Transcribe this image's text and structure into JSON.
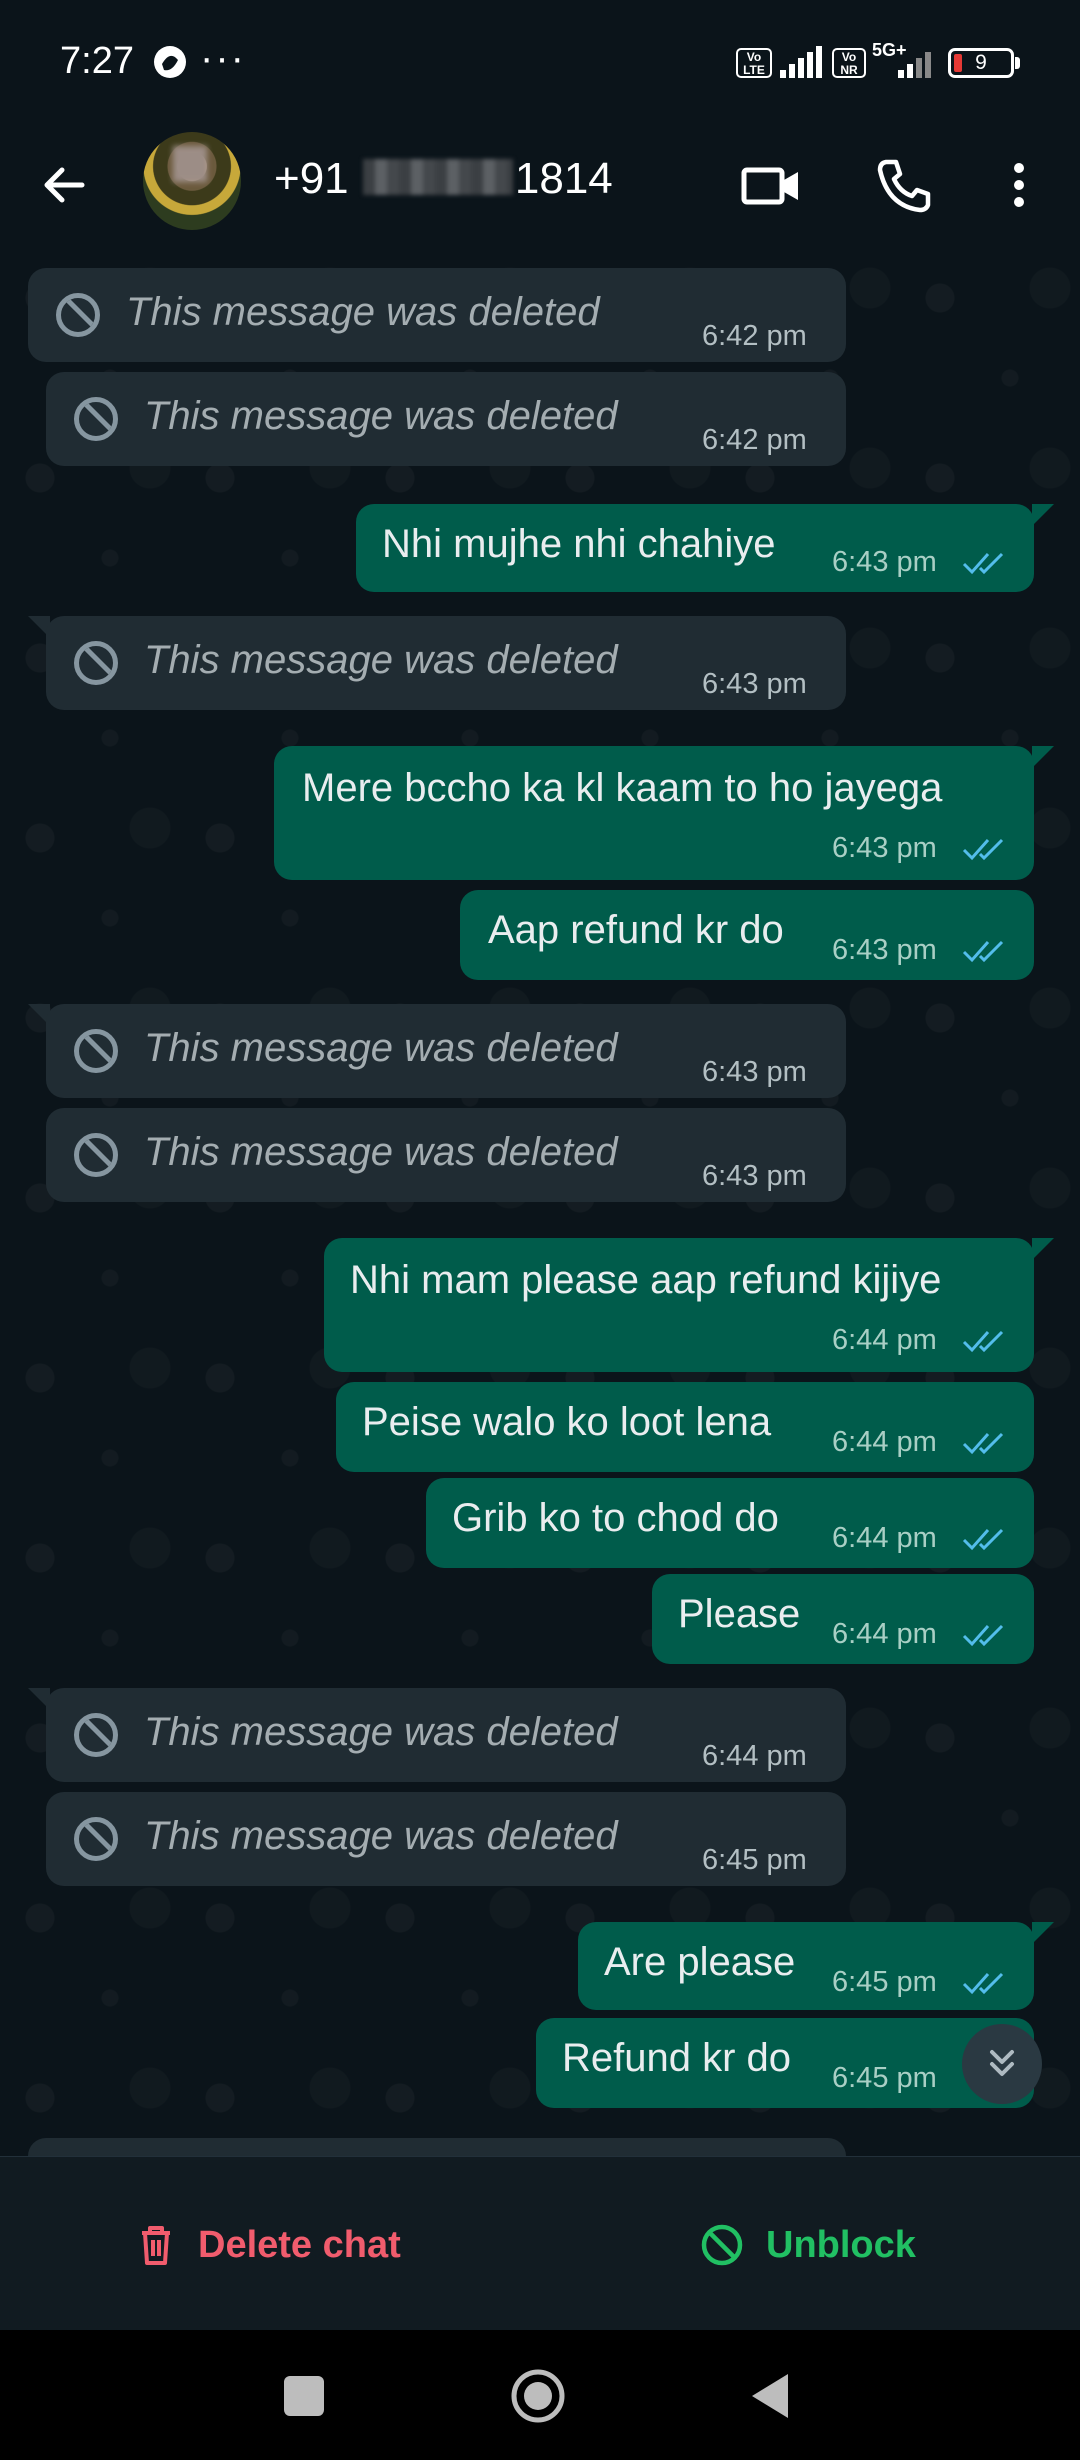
{
  "status_bar": {
    "time": "7:27",
    "dots": "···",
    "vo_lte_1": "Vo LTE",
    "vo_lte_2": "Vo NR",
    "network": "5G+",
    "battery": "9"
  },
  "header": {
    "contact_prefix": "+91",
    "contact_suffix": "1814",
    "icons": [
      "back-arrow-icon",
      "video-call-icon",
      "voice-call-icon",
      "more-vert-icon"
    ]
  },
  "messages": [
    {
      "dir": "in",
      "deleted": true,
      "text": "This message was deleted",
      "time": "6:42 pm"
    },
    {
      "dir": "in",
      "deleted": true,
      "text": "This message was deleted",
      "time": "6:42 pm"
    },
    {
      "dir": "out",
      "text": "Nhi mujhe nhi chahiye",
      "time": "6:43 pm"
    },
    {
      "dir": "in",
      "deleted": true,
      "text": "This message was deleted",
      "time": "6:43 pm"
    },
    {
      "dir": "out",
      "text": "Mere bccho ka kl kaam to ho jayega",
      "time": "6:43 pm"
    },
    {
      "dir": "out",
      "text": "Aap refund kr do",
      "time": "6:43 pm"
    },
    {
      "dir": "in",
      "deleted": true,
      "text": "This message was deleted",
      "time": "6:43 pm"
    },
    {
      "dir": "in",
      "deleted": true,
      "text": "This message was deleted",
      "time": "6:43 pm"
    },
    {
      "dir": "out",
      "text": "Nhi mam please aap refund kijiye",
      "time": "6:44 pm"
    },
    {
      "dir": "out",
      "text": "Peise walo ko loot lena",
      "time": "6:44 pm"
    },
    {
      "dir": "out",
      "text": "Grib ko to chod do",
      "time": "6:44 pm"
    },
    {
      "dir": "out",
      "text": "Please",
      "time": "6:44 pm"
    },
    {
      "dir": "in",
      "deleted": true,
      "text": "This message was deleted",
      "time": "6:44 pm"
    },
    {
      "dir": "in",
      "deleted": true,
      "text": "This message was deleted",
      "time": "6:45 pm"
    },
    {
      "dir": "out",
      "text": "Are please",
      "time": "6:45 pm"
    },
    {
      "dir": "out",
      "text": "Refund kr do",
      "time": "6:45 pm"
    }
  ],
  "actions": {
    "delete_label": "Delete chat",
    "unblock_label": "Unblock"
  },
  "colors": {
    "outgoing_bubble": "#005c4b",
    "incoming_bubble": "#202c33",
    "delete_red": "#f15c6d",
    "unblock_green": "#21c063",
    "read_ticks": "#53bdeb"
  }
}
